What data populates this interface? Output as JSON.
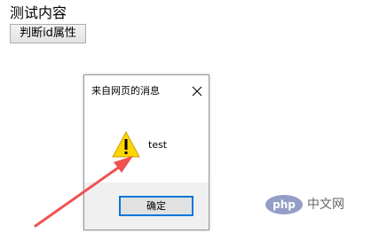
{
  "page": {
    "content_text": "测试内容",
    "button_label": "判断id属性"
  },
  "dialog": {
    "title": "来自网页的消息",
    "close_icon": "close-icon",
    "icon": "warning-icon",
    "message": "test",
    "ok_label": "确定"
  },
  "watermark": {
    "logo_text": "php",
    "site_text": "中文网"
  },
  "colors": {
    "accent_border": "#0078d7",
    "warning_yellow": "#ffd700",
    "annotation_arrow": "#f05252"
  }
}
